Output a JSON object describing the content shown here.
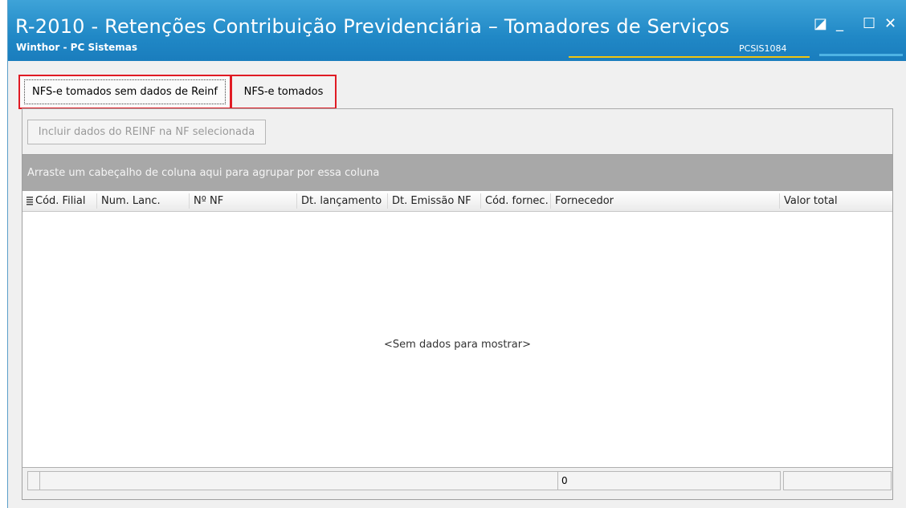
{
  "window": {
    "title": "R-2010 - Retenções Contribuição Previdenciária – Tomadores de Serviços",
    "subtitle": "Winthor - PC Sistemas",
    "code": "PCSIS1084",
    "controls": {
      "restore": "◪",
      "minimize": "_",
      "maximize": "☐",
      "close": "✕"
    }
  },
  "tabs": [
    {
      "label": "NFS-e tomados sem dados de Reinf",
      "active": true
    },
    {
      "label": "NFS-e tomados",
      "active": false
    }
  ],
  "toolbar": {
    "include_button": "Incluir dados do REINF na NF selecionada"
  },
  "grid": {
    "group_panel_text": "Arraste um cabeçalho de coluna aqui para agrupar por essa coluna",
    "columns": [
      "Cód. Filial",
      "Num. Lanc.",
      "Nº NF",
      "Dt. lançamento",
      "Dt. Emissão NF",
      "Cód. fornec.",
      "Fornecedor",
      "Valor total"
    ],
    "empty_text": "<Sem dados para mostrar>",
    "footer_total": "0"
  },
  "colors": {
    "titlebar": "#2088c6",
    "highlight": "#e01b24",
    "group_panel": "#a8a8a8"
  }
}
